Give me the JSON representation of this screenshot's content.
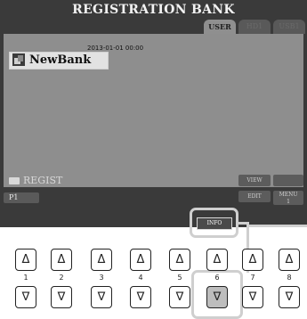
{
  "display": {
    "title": "REGISTRATION BANK",
    "tabs": [
      {
        "label": "USER",
        "active": true
      },
      {
        "label": "HD1",
        "active": false
      },
      {
        "label": "USB1",
        "active": false
      }
    ],
    "bank": {
      "date": "2013-01-01 00:00",
      "name": "NewBank"
    },
    "folder_label": "REGIST",
    "page_label": "P1",
    "view_label": "VIEW",
    "info_label": "INFO",
    "edit_label": "EDIT",
    "menu_label_line1": "MENU",
    "menu_label_line2": "1"
  },
  "buttons": {
    "upper_symbol": "Δ",
    "lower_symbol": "∇",
    "numbers": [
      "1",
      "2",
      "3",
      "4",
      "5",
      "6",
      "7",
      "8"
    ],
    "pressed_lower": "6"
  },
  "colors": {
    "screen": "#3a3a3a",
    "content": "#8e8e8e",
    "highlight": "#cfcfcf"
  }
}
